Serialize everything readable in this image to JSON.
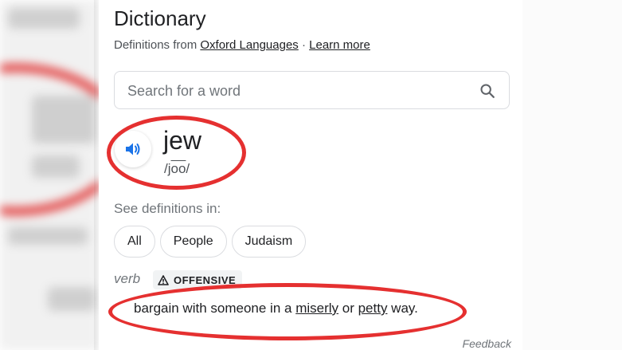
{
  "dictionary": {
    "title": "Dictionary",
    "source_prefix": "Definitions from",
    "source_name": "Oxford Languages",
    "separator": " · ",
    "learn_more": "Learn more"
  },
  "search": {
    "placeholder": "Search for a word"
  },
  "entry": {
    "word": "jew",
    "phonetic_start": "/j",
    "phonetic_over": "oo",
    "phonetic_end": "/"
  },
  "see_definitions": {
    "label": "See definitions in:",
    "chips": [
      "All",
      "People",
      "Judaism"
    ]
  },
  "sense": {
    "part_of_speech": "verb",
    "badge": "OFFENSIVE",
    "definition_start": "bargain with someone in a ",
    "word1": "miserly",
    "mid": " or ",
    "word2": "petty",
    "definition_end": " way."
  },
  "footer": {
    "feedback": "Feedback"
  },
  "icons": {
    "search": "search-icon",
    "speaker": "speaker-icon",
    "warning": "warning-icon"
  },
  "colors": {
    "annotation_red": "#e53030",
    "speaker_blue": "#1a73e8",
    "text": "#202124",
    "muted": "#70757a"
  }
}
